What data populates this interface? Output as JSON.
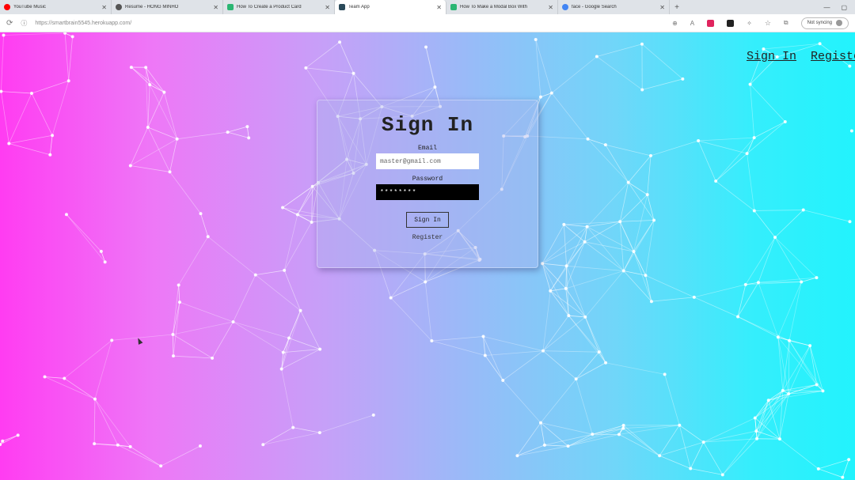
{
  "browser": {
    "tabs": [
      {
        "label": "YouTube Music",
        "favicon_color": "#ff0000",
        "active": false
      },
      {
        "label": "Resume - HONG MINHO",
        "favicon_color": "#555555",
        "active": false
      },
      {
        "label": "How To Create a Product Card",
        "favicon_color": "#2bb673",
        "active": false
      },
      {
        "label": "Team App",
        "favicon_color": "#2b4a5a",
        "active": true
      },
      {
        "label": "How To Make a Modal Box With",
        "favicon_color": "#2bb673",
        "active": false
      },
      {
        "label": "face - Google Search",
        "favicon_color": "#4285f4",
        "active": false
      }
    ],
    "new_tab": "+",
    "url": "https://smartbrain5545.herokuapp.com/",
    "profile_label": "Not syncing"
  },
  "nav": {
    "signin_label": "Sign In",
    "register_label": "Register"
  },
  "form": {
    "title": "Sign In",
    "email_label": "Email",
    "email_value": "master@gmail.com",
    "password_label": "Password",
    "password_value": "********",
    "submit_label": "Sign In",
    "register_link": "Register"
  },
  "colors": {
    "gradient_left": "#ff3cf2",
    "gradient_right": "#22f3fd"
  }
}
